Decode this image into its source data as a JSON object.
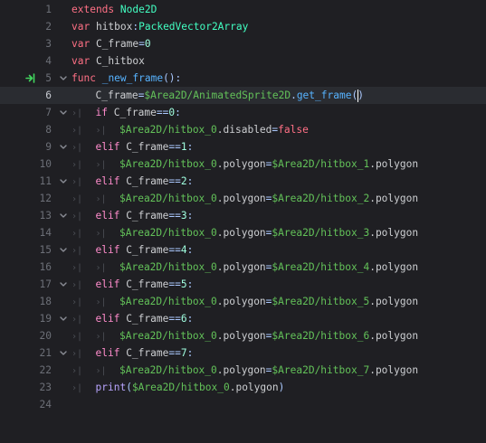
{
  "colors": {
    "background": "#1f1f23",
    "current_line": "#2a2c31",
    "keyword": "#ff7085",
    "control_flow": "#ff8ccc",
    "type": "#42ffc2",
    "node_path": "#63c259",
    "function": "#57b3ff",
    "builtin": "#b9a5ff",
    "number": "#a1ffe0"
  },
  "editor": {
    "current_line": 6,
    "lines": [
      {
        "num": "1",
        "fold": false,
        "indent": 0,
        "tokens": [
          {
            "t": "extends",
            "c": "kw-extends"
          },
          {
            "t": " ",
            "c": "t-plain"
          },
          {
            "t": "Node2D",
            "c": "t-type"
          }
        ]
      },
      {
        "num": "2",
        "fold": false,
        "indent": 0,
        "tokens": [
          {
            "t": "var",
            "c": "kw-var"
          },
          {
            "t": " hitbox",
            "c": "t-plain"
          },
          {
            "t": ":",
            "c": "t-sym"
          },
          {
            "t": "PackedVector2Array",
            "c": "t-type"
          }
        ]
      },
      {
        "num": "3",
        "fold": false,
        "indent": 0,
        "tokens": [
          {
            "t": "var",
            "c": "kw-var"
          },
          {
            "t": " C_frame",
            "c": "t-plain"
          },
          {
            "t": "=",
            "c": "t-sym"
          },
          {
            "t": "0",
            "c": "t-num"
          }
        ]
      },
      {
        "num": "4",
        "fold": false,
        "indent": 0,
        "tokens": [
          {
            "t": "var",
            "c": "kw-var"
          },
          {
            "t": " C_hitbox",
            "c": "t-plain"
          }
        ]
      },
      {
        "num": "5",
        "fold": true,
        "exec": true,
        "indent": 0,
        "tokens": [
          {
            "t": "func",
            "c": "kw-func"
          },
          {
            "t": " ",
            "c": "t-plain"
          },
          {
            "t": "_new_frame",
            "c": "t-func"
          },
          {
            "t": "():",
            "c": "t-sym"
          }
        ]
      },
      {
        "num": "6",
        "fold": false,
        "indent": 1,
        "caret": true,
        "tokens": [
          {
            "t": "C_frame",
            "c": "t-plain"
          },
          {
            "t": "=",
            "c": "t-sym"
          },
          {
            "t": "$Area2D/AnimatedSprite2D",
            "c": "t-node"
          },
          {
            "t": ".",
            "c": "t-sym"
          },
          {
            "t": "get_frame",
            "c": "t-func"
          },
          {
            "t": "(",
            "c": "t-sym"
          },
          {
            "t": ")",
            "c": "t-sym"
          }
        ]
      },
      {
        "num": "7",
        "fold": true,
        "indent": 1,
        "tokens": [
          {
            "t": "if",
            "c": "kw-flow"
          },
          {
            "t": " C_frame",
            "c": "t-plain"
          },
          {
            "t": "==",
            "c": "t-sym"
          },
          {
            "t": "0",
            "c": "t-num"
          },
          {
            "t": ":",
            "c": "t-sym"
          }
        ]
      },
      {
        "num": "8",
        "fold": false,
        "indent": 2,
        "tokens": [
          {
            "t": "$Area2D/hitbox_0",
            "c": "t-node"
          },
          {
            "t": ".disabled",
            "c": "t-plain"
          },
          {
            "t": "=",
            "c": "t-sym"
          },
          {
            "t": "false",
            "c": "t-bool"
          }
        ]
      },
      {
        "num": "9",
        "fold": true,
        "indent": 1,
        "tokens": [
          {
            "t": "elif",
            "c": "kw-flow"
          },
          {
            "t": " C_frame",
            "c": "t-plain"
          },
          {
            "t": "==",
            "c": "t-sym"
          },
          {
            "t": "1",
            "c": "t-num"
          },
          {
            "t": ":",
            "c": "t-sym"
          }
        ]
      },
      {
        "num": "10",
        "fold": false,
        "indent": 2,
        "tokens": [
          {
            "t": "$Area2D/hitbox_0",
            "c": "t-node"
          },
          {
            "t": ".polygon",
            "c": "t-plain"
          },
          {
            "t": "=",
            "c": "t-sym"
          },
          {
            "t": "$Area2D/hitbox_1",
            "c": "t-node"
          },
          {
            "t": ".polygon",
            "c": "t-plain"
          }
        ]
      },
      {
        "num": "11",
        "fold": true,
        "indent": 1,
        "tokens": [
          {
            "t": "elif",
            "c": "kw-flow"
          },
          {
            "t": " C_frame",
            "c": "t-plain"
          },
          {
            "t": "==",
            "c": "t-sym"
          },
          {
            "t": "2",
            "c": "t-num"
          },
          {
            "t": ":",
            "c": "t-sym"
          }
        ]
      },
      {
        "num": "12",
        "fold": false,
        "indent": 2,
        "tokens": [
          {
            "t": "$Area2D/hitbox_0",
            "c": "t-node"
          },
          {
            "t": ".polygon",
            "c": "t-plain"
          },
          {
            "t": "=",
            "c": "t-sym"
          },
          {
            "t": "$Area2D/hitbox_2",
            "c": "t-node"
          },
          {
            "t": ".polygon",
            "c": "t-plain"
          }
        ]
      },
      {
        "num": "13",
        "fold": true,
        "indent": 1,
        "tokens": [
          {
            "t": "elif",
            "c": "kw-flow"
          },
          {
            "t": " C_frame",
            "c": "t-plain"
          },
          {
            "t": "==",
            "c": "t-sym"
          },
          {
            "t": "3",
            "c": "t-num"
          },
          {
            "t": ":",
            "c": "t-sym"
          }
        ]
      },
      {
        "num": "14",
        "fold": false,
        "indent": 2,
        "tokens": [
          {
            "t": "$Area2D/hitbox_0",
            "c": "t-node"
          },
          {
            "t": ".polygon",
            "c": "t-plain"
          },
          {
            "t": "=",
            "c": "t-sym"
          },
          {
            "t": "$Area2D/hitbox_3",
            "c": "t-node"
          },
          {
            "t": ".polygon",
            "c": "t-plain"
          }
        ]
      },
      {
        "num": "15",
        "fold": true,
        "indent": 1,
        "tokens": [
          {
            "t": "elif",
            "c": "kw-flow"
          },
          {
            "t": " C_frame",
            "c": "t-plain"
          },
          {
            "t": "==",
            "c": "t-sym"
          },
          {
            "t": "4",
            "c": "t-num"
          },
          {
            "t": ":",
            "c": "t-sym"
          }
        ]
      },
      {
        "num": "16",
        "fold": false,
        "indent": 2,
        "tokens": [
          {
            "t": "$Area2D/hitbox_0",
            "c": "t-node"
          },
          {
            "t": ".polygon",
            "c": "t-plain"
          },
          {
            "t": "=",
            "c": "t-sym"
          },
          {
            "t": "$Area2D/hitbox_4",
            "c": "t-node"
          },
          {
            "t": ".polygon",
            "c": "t-plain"
          }
        ]
      },
      {
        "num": "17",
        "fold": true,
        "indent": 1,
        "tokens": [
          {
            "t": "elif",
            "c": "kw-flow"
          },
          {
            "t": " C_frame",
            "c": "t-plain"
          },
          {
            "t": "==",
            "c": "t-sym"
          },
          {
            "t": "5",
            "c": "t-num"
          },
          {
            "t": ":",
            "c": "t-sym"
          }
        ]
      },
      {
        "num": "18",
        "fold": false,
        "indent": 2,
        "tokens": [
          {
            "t": "$Area2D/hitbox_0",
            "c": "t-node"
          },
          {
            "t": ".polygon",
            "c": "t-plain"
          },
          {
            "t": "=",
            "c": "t-sym"
          },
          {
            "t": "$Area2D/hitbox_5",
            "c": "t-node"
          },
          {
            "t": ".polygon",
            "c": "t-plain"
          }
        ]
      },
      {
        "num": "19",
        "fold": true,
        "indent": 1,
        "tokens": [
          {
            "t": "elif",
            "c": "kw-flow"
          },
          {
            "t": " C_frame",
            "c": "t-plain"
          },
          {
            "t": "==",
            "c": "t-sym"
          },
          {
            "t": "6",
            "c": "t-num"
          },
          {
            "t": ":",
            "c": "t-sym"
          }
        ]
      },
      {
        "num": "20",
        "fold": false,
        "indent": 2,
        "tokens": [
          {
            "t": "$Area2D/hitbox_0",
            "c": "t-node"
          },
          {
            "t": ".polygon",
            "c": "t-plain"
          },
          {
            "t": "=",
            "c": "t-sym"
          },
          {
            "t": "$Area2D/hitbox_6",
            "c": "t-node"
          },
          {
            "t": ".polygon",
            "c": "t-plain"
          }
        ]
      },
      {
        "num": "21",
        "fold": true,
        "indent": 1,
        "tokens": [
          {
            "t": "elif",
            "c": "kw-flow"
          },
          {
            "t": " C_frame",
            "c": "t-plain"
          },
          {
            "t": "==",
            "c": "t-sym"
          },
          {
            "t": "7",
            "c": "t-num"
          },
          {
            "t": ":",
            "c": "t-sym"
          }
        ]
      },
      {
        "num": "22",
        "fold": false,
        "indent": 2,
        "tokens": [
          {
            "t": "$Area2D/hitbox_0",
            "c": "t-node"
          },
          {
            "t": ".polygon",
            "c": "t-plain"
          },
          {
            "t": "=",
            "c": "t-sym"
          },
          {
            "t": "$Area2D/hitbox_7",
            "c": "t-node"
          },
          {
            "t": ".polygon",
            "c": "t-plain"
          }
        ]
      },
      {
        "num": "23",
        "fold": false,
        "indent": 1,
        "tokens": [
          {
            "t": "print",
            "c": "t-builtin"
          },
          {
            "t": "(",
            "c": "t-sym"
          },
          {
            "t": "$Area2D/hitbox_0",
            "c": "t-node"
          },
          {
            "t": ".polygon",
            "c": "t-plain"
          },
          {
            "t": ")",
            "c": "t-sym"
          }
        ]
      },
      {
        "num": "24",
        "fold": false,
        "indent": 0,
        "tokens": []
      }
    ]
  }
}
